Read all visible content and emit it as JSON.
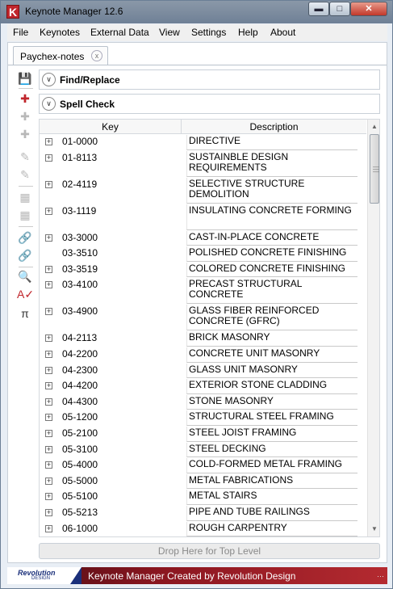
{
  "window": {
    "title": "Keynote Manager 12.6",
    "app_icon_letter": "K"
  },
  "menu": [
    "File",
    "Keynotes",
    "External Data",
    "View",
    "Settings",
    "Help",
    "About"
  ],
  "tab": {
    "label": "Paychex-notes",
    "close_glyph": "x"
  },
  "panels": {
    "find_replace": "Find/Replace",
    "spell_check": "Spell Check"
  },
  "grid": {
    "columns": {
      "key": "Key",
      "description": "Description"
    },
    "rows": [
      {
        "key": "01-0000",
        "desc": "DIRECTIVE",
        "expand": true
      },
      {
        "key": "01-8113",
        "desc": "SUSTAINBLE DESIGN REQUIREMENTS",
        "expand": true
      },
      {
        "key": "02-4119",
        "desc": "SELECTIVE STRUCTURE DEMOLITION",
        "expand": true
      },
      {
        "key": "03-1119",
        "desc": "INSULATING CONCRETE FORMING",
        "expand": true
      },
      {
        "key": "03-3000",
        "desc": "CAST-IN-PLACE CONCRETE",
        "expand": true
      },
      {
        "key": "03-3510",
        "desc": "POLISHED CONCRETE FINISHING",
        "expand": false
      },
      {
        "key": "03-3519",
        "desc": "COLORED CONCRETE FINISHING",
        "expand": true
      },
      {
        "key": "03-4100",
        "desc": "PRECAST STRUCTURAL CONCRETE",
        "expand": true
      },
      {
        "key": "03-4900",
        "desc": "GLASS FIBER REINFORCED CONCRETE (GFRC)",
        "expand": true
      },
      {
        "key": "04-2113",
        "desc": "BRICK MASONRY",
        "expand": true
      },
      {
        "key": "04-2200",
        "desc": "CONCRETE UNIT MASONRY",
        "expand": true
      },
      {
        "key": "04-2300",
        "desc": "GLASS UNIT MASONRY",
        "expand": true
      },
      {
        "key": "04-4200",
        "desc": "EXTERIOR STONE CLADDING",
        "expand": true
      },
      {
        "key": "04-4300",
        "desc": "STONE MASONRY",
        "expand": true
      },
      {
        "key": "05-1200",
        "desc": "STRUCTURAL STEEL FRAMING",
        "expand": true
      },
      {
        "key": "05-2100",
        "desc": "STEEL JOIST FRAMING",
        "expand": true
      },
      {
        "key": "05-3100",
        "desc": "STEEL DECKING",
        "expand": true
      },
      {
        "key": "05-4000",
        "desc": "COLD-FORMED METAL FRAMING",
        "expand": true
      },
      {
        "key": "05-5000",
        "desc": "METAL FABRICATIONS",
        "expand": true
      },
      {
        "key": "05-5100",
        "desc": "METAL STAIRS",
        "expand": true
      },
      {
        "key": "05-5213",
        "desc": "PIPE AND TUBE RAILINGS",
        "expand": true
      },
      {
        "key": "06-1000",
        "desc": "ROUGH CARPENTRY",
        "expand": true
      }
    ]
  },
  "drop_zone": "Drop Here for Top Level",
  "footer": {
    "logo": "Revolution",
    "logo_sub": "DESIGN",
    "text": "Keynote Manager Created by Revolution Design"
  },
  "colors": {
    "accent_red": "#c0262c",
    "footer_dark": "#4a0d14",
    "logo_blue": "#1a2f7a"
  }
}
